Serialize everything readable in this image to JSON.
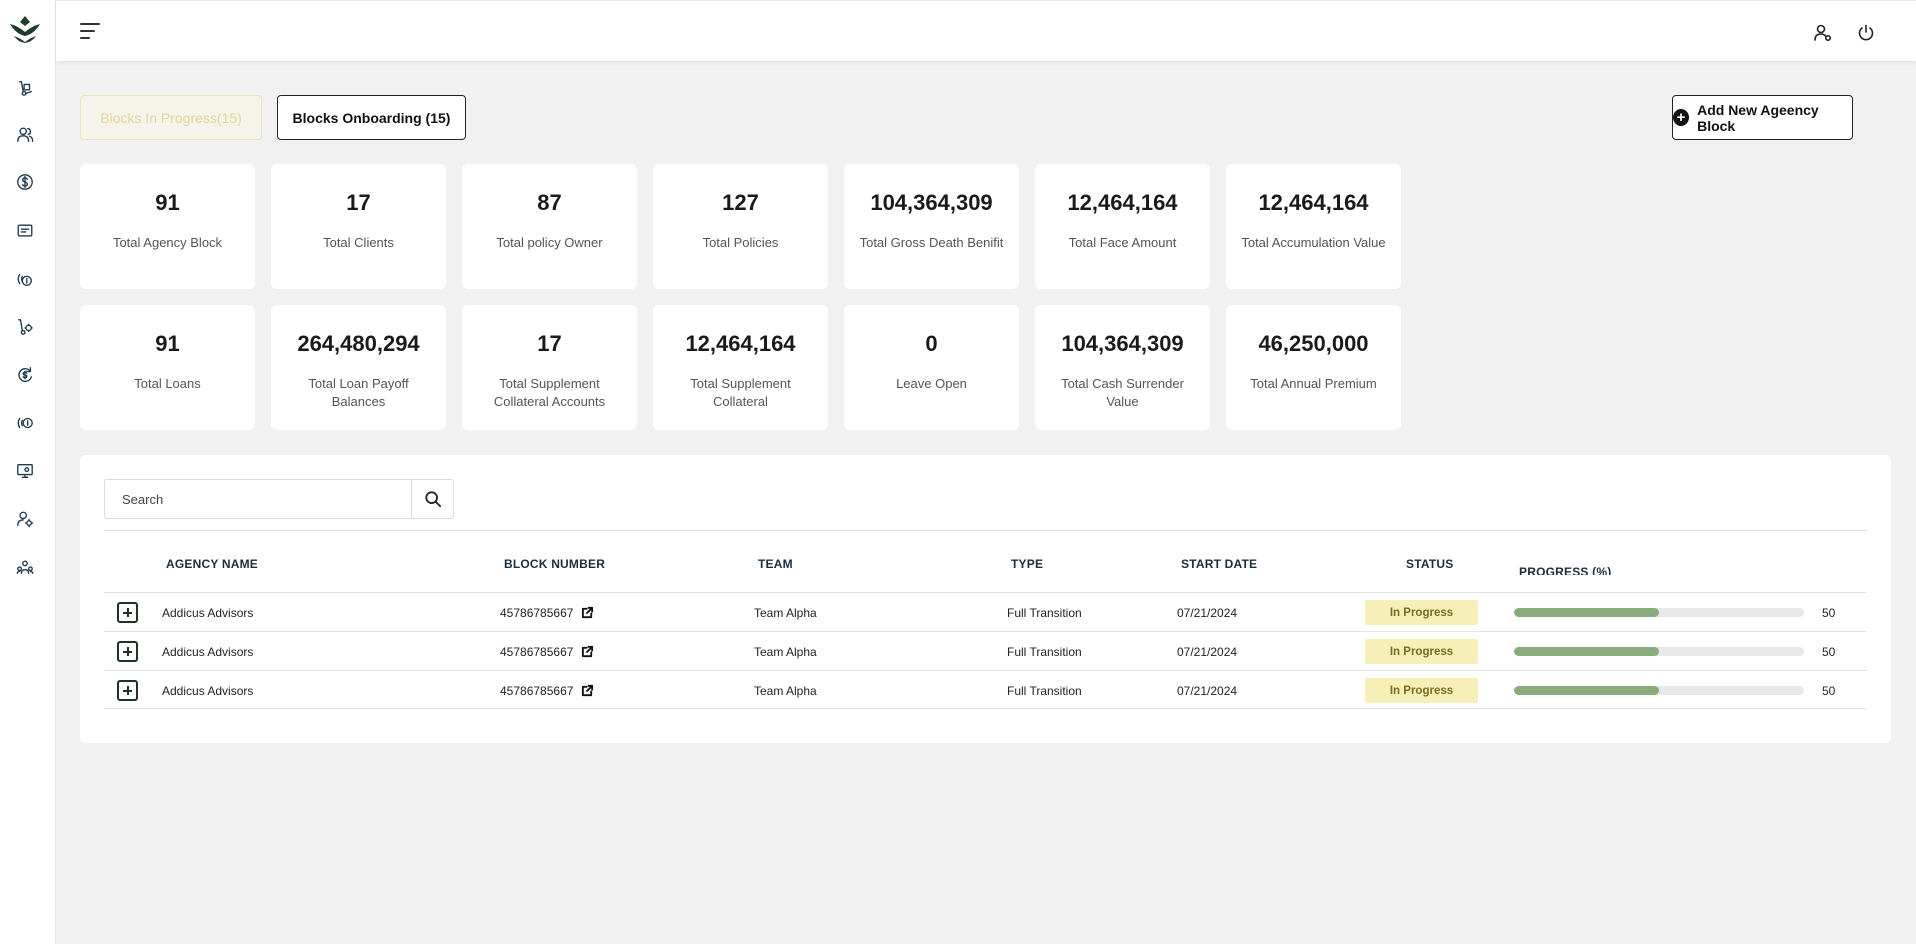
{
  "header": {
    "menu_icon": "hamburger-menu-icon",
    "user_settings_icon": "user-settings-icon",
    "power_icon": "power-icon"
  },
  "sidebar": {
    "logo": "brand-logo",
    "items": [
      {
        "icon": "hand-truck-icon"
      },
      {
        "icon": "users-icon"
      },
      {
        "icon": "dollar-circle-icon"
      },
      {
        "icon": "message-icon"
      },
      {
        "icon": "signal-money-icon"
      },
      {
        "icon": "hand-truck-settings-icon"
      },
      {
        "icon": "dollar-refresh-icon"
      },
      {
        "icon": "broadcast-money-icon"
      },
      {
        "icon": "monitor-settings-icon"
      },
      {
        "icon": "user-gear-icon"
      },
      {
        "icon": "team-network-icon"
      }
    ]
  },
  "tabs": {
    "in_progress": "Blocks In Progress(15)",
    "onboarding": "Blocks Onboarding (15)"
  },
  "add_button": "Add New Ageency Block",
  "stats": [
    {
      "value": "91",
      "label": "Total Agency Block"
    },
    {
      "value": "17",
      "label": "Total Clients"
    },
    {
      "value": "87",
      "label": "Total policy Owner"
    },
    {
      "value": "127",
      "label": "Total Policies"
    },
    {
      "value": "104,364,309",
      "label": "Total Gross Death Benifit"
    },
    {
      "value": "12,464,164",
      "label": "Total Face Amount"
    },
    {
      "value": "12,464,164",
      "label": "Total Accumulation Value"
    },
    {
      "value": "91",
      "label": "Total Loans"
    },
    {
      "value": "264,480,294",
      "label": "Total Loan Payoff Balances"
    },
    {
      "value": "17",
      "label": "Total Supplement Collateral Accounts"
    },
    {
      "value": "12,464,164",
      "label": "Total Supplement Collateral"
    },
    {
      "value": "0",
      "label": "Leave Open"
    },
    {
      "value": "104,364,309",
      "label": "Total Cash Surrender Value"
    },
    {
      "value": "46,250,000",
      "label": "Total Annual Premium"
    }
  ],
  "search": {
    "placeholder": "Search"
  },
  "table": {
    "columns": {
      "agency_name": "AGENCY NAME",
      "block_number": "BLOCK NUMBER",
      "team": "TEAM",
      "type": "TYPE",
      "start_date": "START DATE",
      "status": "STATUS",
      "progress": "PROGRESS (%)"
    },
    "rows": [
      {
        "agency_name": "Addicus Advisors",
        "block_number": "45786785667",
        "team": "Team Alpha",
        "type": "Full Transition",
        "start_date": "07/21/2024",
        "status": "In Progress",
        "progress": "50",
        "progress_value": 50
      },
      {
        "agency_name": "Addicus Advisors",
        "block_number": "45786785667",
        "team": "Team Alpha",
        "type": "Full Transition",
        "start_date": "07/21/2024",
        "status": "In Progress",
        "progress": "50",
        "progress_value": 50
      },
      {
        "agency_name": "Addicus Advisors",
        "block_number": "45786785667",
        "team": "Team Alpha",
        "type": "Full Transition",
        "start_date": "07/21/2024",
        "status": "In Progress",
        "progress": "50",
        "progress_value": 50
      }
    ]
  },
  "colors": {
    "progress_fill": "#88ad7a",
    "status_bg": "#f7efb8",
    "active_tab_text": "#e4d59a"
  }
}
